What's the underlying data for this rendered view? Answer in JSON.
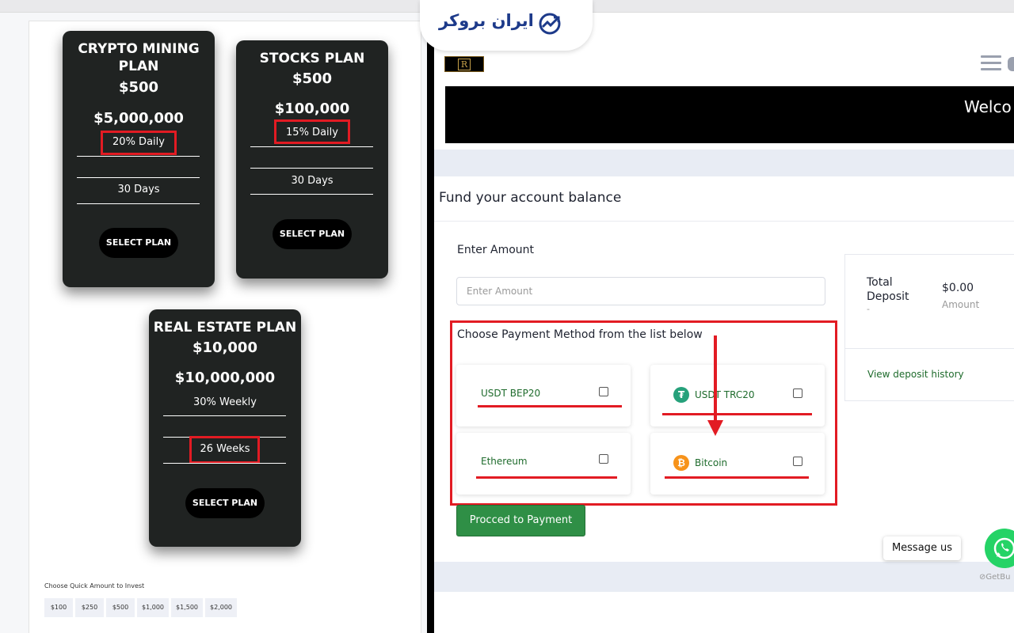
{
  "brand": {
    "name": "ایران بروکر"
  },
  "plans": [
    {
      "name_line1": "CRYPTO MINING",
      "name_line2": "PLAN",
      "min": "$500",
      "max": "$5,000,000",
      "roi": "20% Daily",
      "duration": "30 Days",
      "button": "SELECT PLAN"
    },
    {
      "name_line1": "STOCKS PLAN",
      "min": "$500",
      "max": "$100,000",
      "roi": "15% Daily",
      "duration": "30 Days",
      "button": "SELECT PLAN"
    },
    {
      "name_line1": "REAL ESTATE PLAN",
      "min": "$10,000",
      "max": "$10,000,000",
      "roi": "30% Weekly",
      "duration": "26 Weeks",
      "button": "SELECT PLAN"
    }
  ],
  "quick": {
    "label": "Choose Quick Amount to Invest",
    "amounts": [
      "$100",
      "$250",
      "$500",
      "$1,000",
      "$1,500",
      "$2,000"
    ]
  },
  "header": {
    "logo": "R",
    "welcome": "Welco"
  },
  "fund": {
    "title": "Fund your account balance",
    "amount_label": "Enter Amount",
    "amount_placeholder": "Enter Amount",
    "amount_value": "",
    "method_title": "Choose Payment Method from the list below",
    "methods": [
      {
        "label": "USDT BEP20",
        "icon": "",
        "checked": false
      },
      {
        "label": "USDT TRC20",
        "icon": "tether-icon",
        "checked": false
      },
      {
        "label": "Ethereum",
        "icon": "",
        "checked": false
      },
      {
        "label": "Bitcoin",
        "icon": "bitcoin-icon",
        "checked": false
      }
    ],
    "proceed": "Procced to Payment"
  },
  "summary": {
    "total_line1": "Total",
    "total_line2": "Deposit",
    "dash": "-",
    "amount": "$0.00",
    "amount_label": "Amount",
    "history_link": "View deposit history"
  },
  "chat": {
    "message": "Message us",
    "powered": "GetBu"
  },
  "colors": {
    "accent_red": "#e21b23",
    "card_bg": "#202322",
    "green": "#2f8f46",
    "link_green": "#1e6b2c"
  }
}
